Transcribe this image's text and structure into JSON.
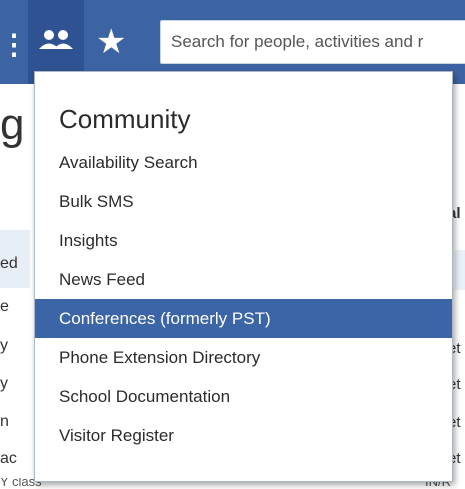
{
  "topbar": {
    "search_placeholder": "Search for people, activities and r",
    "icons": [
      "community-icon",
      "star-icon"
    ]
  },
  "background": {
    "heading_fragment": "g",
    "left_fragments": [
      "ed",
      "e",
      "y",
      "y",
      "n",
      "ac"
    ],
    "right_fragments": [
      "al",
      "et",
      "et",
      "et",
      "et"
    ],
    "bottom_left": "Y class",
    "bottom_right": "IN/R"
  },
  "menu": {
    "title": "Community",
    "items": [
      {
        "label": "Availability Search"
      },
      {
        "label": "Bulk SMS"
      },
      {
        "label": "Insights"
      },
      {
        "label": "News Feed"
      },
      {
        "label": "Conferences (formerly PST)",
        "active": true
      },
      {
        "label": "Phone Extension Directory"
      },
      {
        "label": "School Documentation"
      },
      {
        "label": "Visitor Register"
      }
    ]
  },
  "colors": {
    "topbar": "#3c64a3",
    "active_item": "#3b65a6"
  }
}
